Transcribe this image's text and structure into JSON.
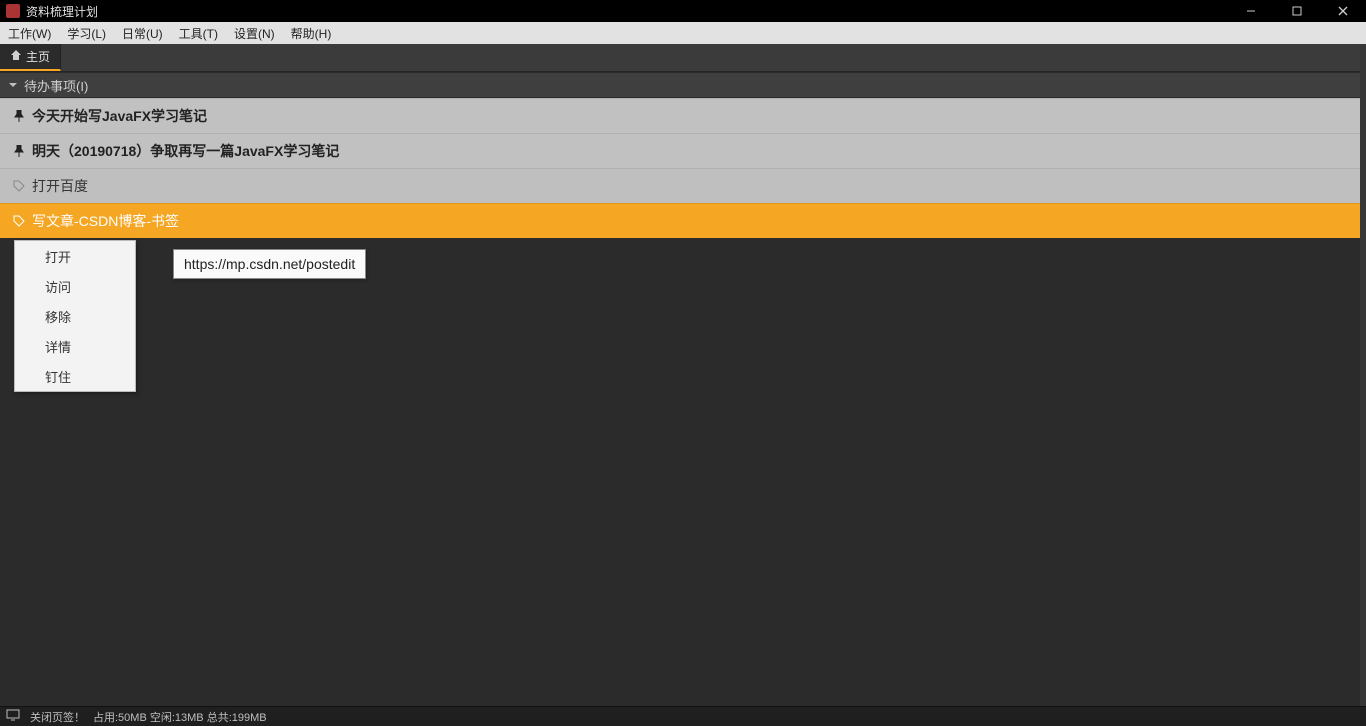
{
  "window": {
    "title": "资料梳理计划"
  },
  "menubar": {
    "items": [
      "工作(W)",
      "学习(L)",
      "日常(U)",
      "工具(T)",
      "设置(N)",
      "帮助(H)"
    ]
  },
  "tabs": {
    "items": [
      {
        "label": "主页",
        "active": true
      }
    ]
  },
  "section": {
    "title": "待办事项(I)"
  },
  "todos": [
    {
      "kind": "pinned",
      "text": "今天开始写JavaFX学习笔记"
    },
    {
      "kind": "pinned",
      "text": "明天（20190718）争取再写一篇JavaFX学习笔记"
    },
    {
      "kind": "plain",
      "text": "打开百度"
    },
    {
      "kind": "selected",
      "text": "写文章-CSDN博客-书签"
    }
  ],
  "context_menu": {
    "items": [
      "打开",
      "访问",
      "移除",
      "详情",
      "钉住"
    ]
  },
  "tooltip": {
    "text": "https://mp.csdn.net/postedit"
  },
  "statusbar": {
    "message": "关闭页签！",
    "memory": "占用:50MB 空闲:13MB 总共:199MB"
  },
  "colors": {
    "accent": "#f5a623"
  }
}
